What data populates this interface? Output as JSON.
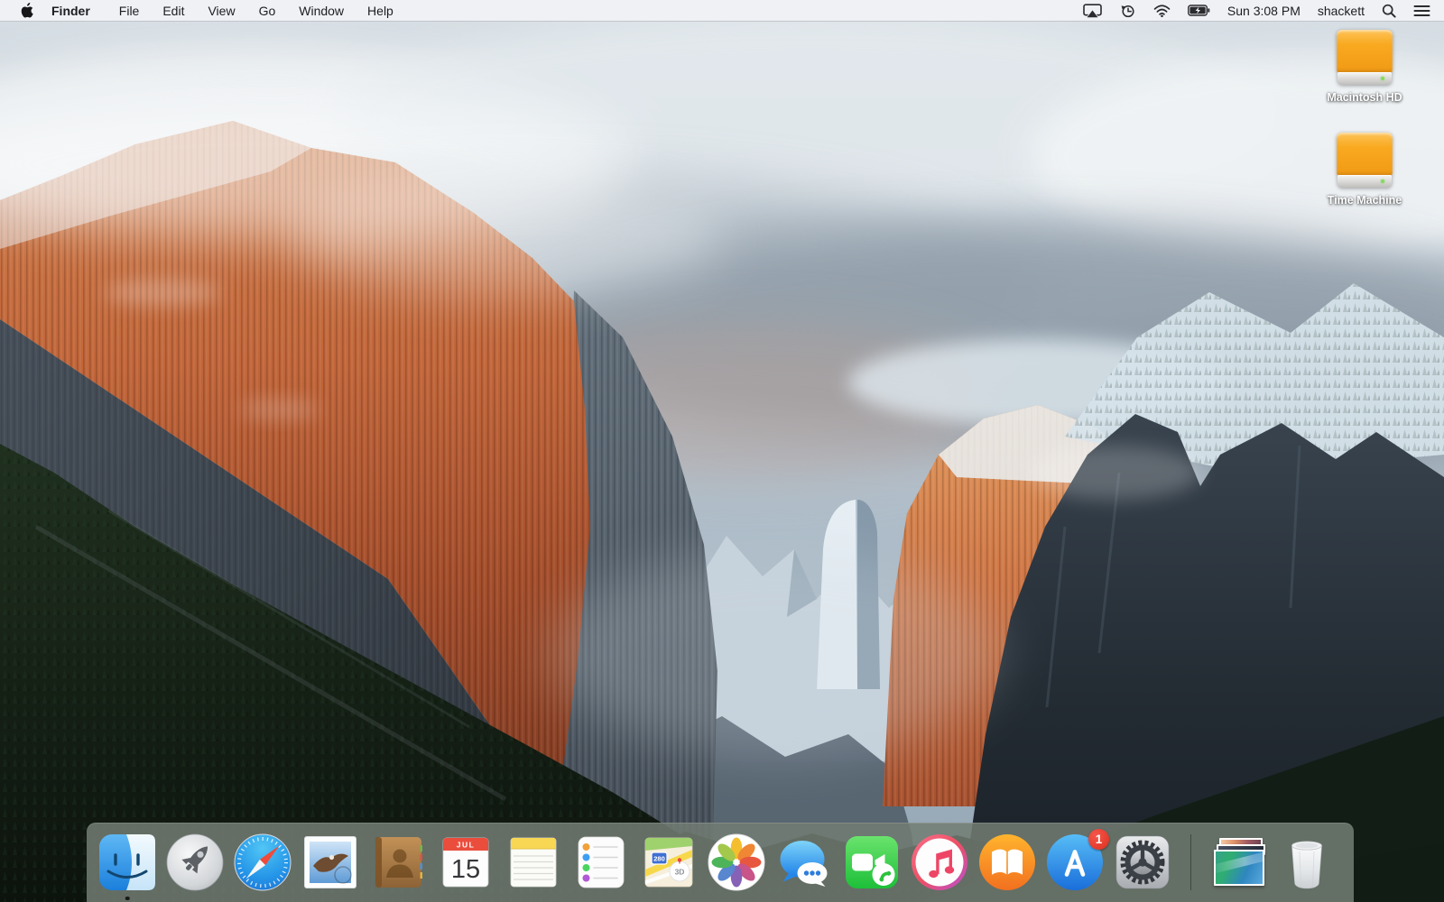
{
  "menu_bar": {
    "app_name": "Finder",
    "menus": [
      "File",
      "Edit",
      "View",
      "Go",
      "Window",
      "Help"
    ],
    "status_right": {
      "time": "Sun 3:08 PM",
      "user": "shackett"
    },
    "status_icons": [
      "airplay-display",
      "time-machine",
      "wifi",
      "battery-charging",
      "spotlight",
      "notification-center"
    ]
  },
  "desktop": {
    "volumes": [
      {
        "label": "Macintosh HD",
        "icon": "orange-external-drive"
      },
      {
        "label": "Time Machine",
        "icon": "orange-external-drive"
      }
    ]
  },
  "dock": {
    "items": [
      "finder",
      "launchpad",
      "safari",
      "mail",
      "contacts",
      "calendar",
      "notes",
      "reminders",
      "maps",
      "photos",
      "messages",
      "facetime",
      "itunes",
      "ibooks",
      "app-store",
      "system-preferences",
      "divider",
      "desktop-pictures-stack",
      "trash"
    ],
    "running_app": "finder",
    "calendar_icon": {
      "month": "JUL",
      "day": "15"
    },
    "maps_icon": {
      "shield": "280",
      "mode": "3D"
    },
    "app_store_badge": "1"
  },
  "colors": {
    "menubar_bg": "#eff1f5",
    "dock_bg": "rgba(114,125,115,0.86)",
    "badge_red": "#e23a2c",
    "drive_orange": "#f8a71f",
    "accent_blue": "#1f84dd",
    "wallpaper_sunlit_orange": "#c2663a",
    "wallpaper_sky": "#bac7d1",
    "wallpaper_forest": "#142016"
  }
}
